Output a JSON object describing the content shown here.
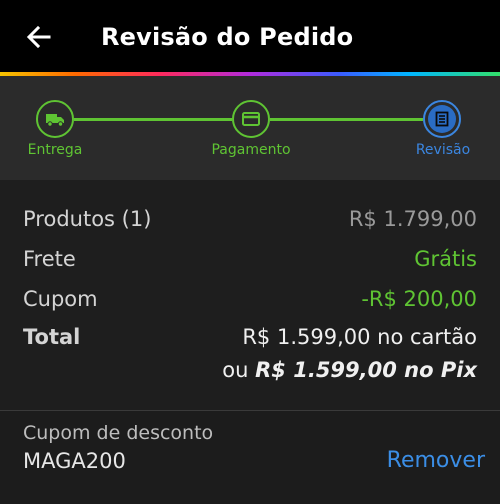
{
  "header": {
    "back_icon": "arrow-left-icon",
    "title": "Revisão do Pedido"
  },
  "colors": {
    "step_done": "#5fc433",
    "step_current": "#3b86e0",
    "discount": "#5fc433",
    "link": "#3b8ee6"
  },
  "steps": [
    {
      "label": "Entrega",
      "icon": "truck-icon",
      "status": "done"
    },
    {
      "label": "Pagamento",
      "icon": "credit-card-icon",
      "status": "done"
    },
    {
      "label": "Revisão",
      "icon": "document-icon",
      "status": "current"
    }
  ],
  "summary": {
    "products_label": "Produtos (1)",
    "products_value": "R$ 1.799,00",
    "shipping_label": "Frete",
    "shipping_value": "Grátis",
    "coupon_label": "Cupom",
    "coupon_value": "-R$ 200,00",
    "total_label": "Total",
    "total_card": "R$ 1.599,00 no cartão",
    "total_pix_prefix": "ou",
    "total_pix": "R$ 1.599,00 no Pix"
  },
  "coupon": {
    "label": "Cupom de desconto",
    "code": "MAGA200",
    "remove_label": "Remover"
  }
}
